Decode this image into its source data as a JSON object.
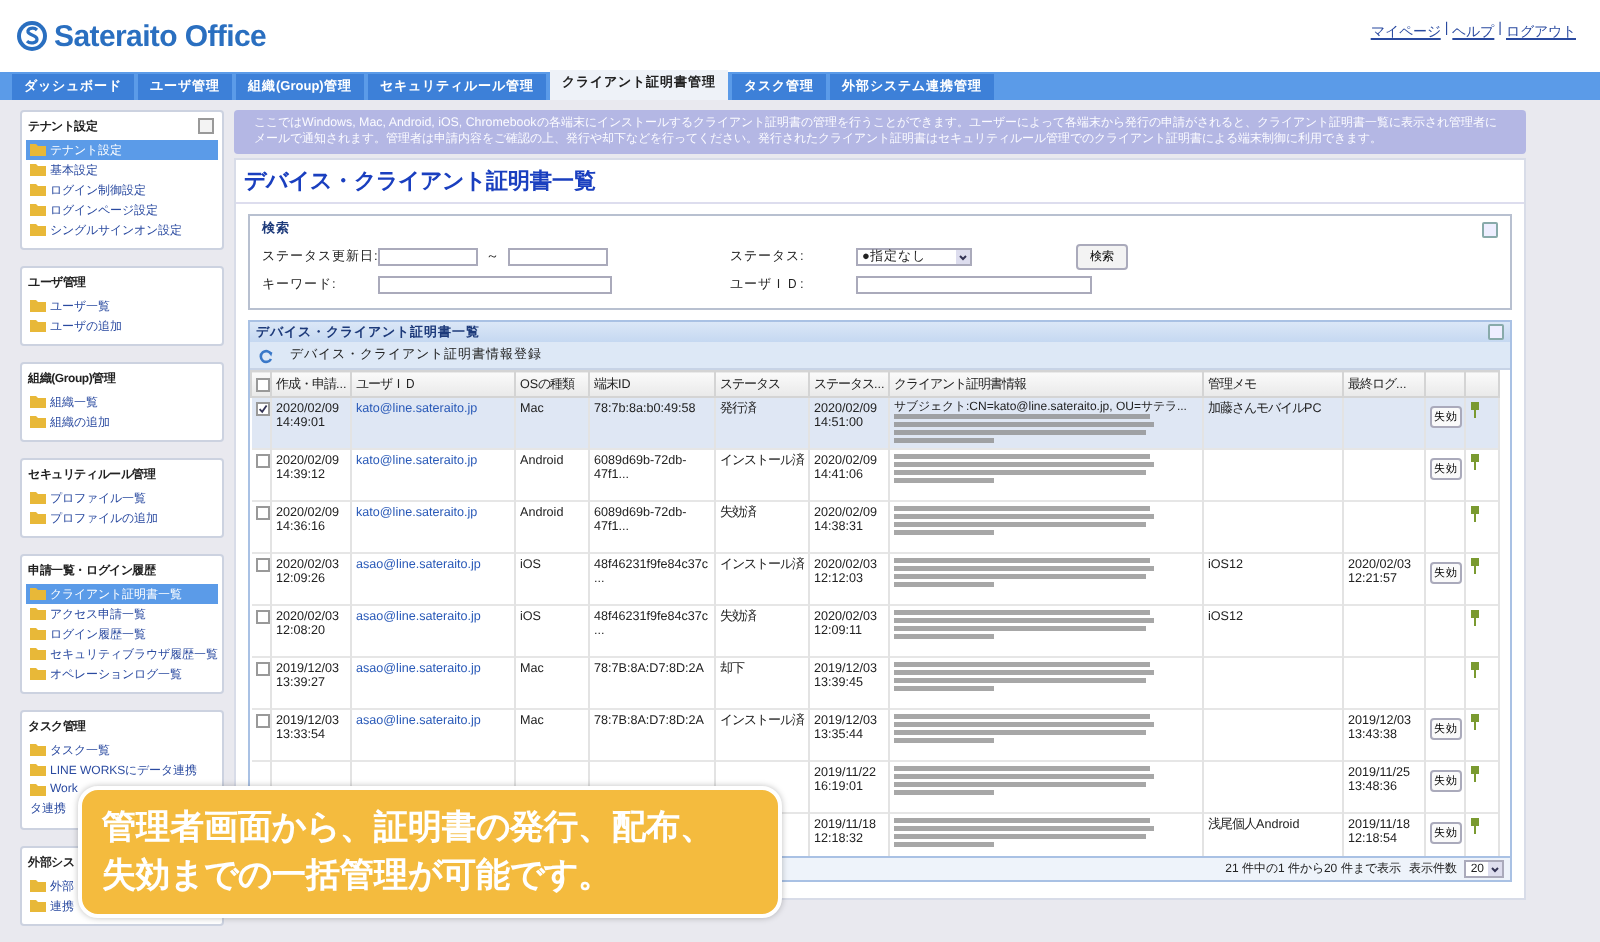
{
  "header": {
    "logo": "Sateraito Office",
    "links": [
      "マイページ",
      "ヘルプ",
      "ログアウト"
    ],
    "separator": "|"
  },
  "nav": [
    {
      "label": "ダッシュボード",
      "selected": false
    },
    {
      "label": "ユーザ管理",
      "selected": false
    },
    {
      "label": "組織(Group)管理",
      "selected": false
    },
    {
      "label": "セキュリティルール管理",
      "selected": false
    },
    {
      "label": "クライアント証明書管理",
      "selected": true
    },
    {
      "label": "タスク管理",
      "selected": false
    },
    {
      "label": "外部システム連携管理",
      "selected": false
    }
  ],
  "sidebar": [
    {
      "title": "テナント設定",
      "collapsible": true,
      "items": [
        {
          "label": "テナント設定",
          "selected": true
        },
        {
          "label": "基本設定",
          "selected": false
        },
        {
          "label": "ログイン制御設定",
          "selected": false
        },
        {
          "label": "ログインページ設定",
          "selected": false
        },
        {
          "label": "シングルサインオン設定",
          "selected": false
        }
      ]
    },
    {
      "title": "ユーザ管理",
      "collapsible": false,
      "items": [
        {
          "label": "ユーザ一覧",
          "selected": false
        },
        {
          "label": "ユーザの追加",
          "selected": false
        }
      ]
    },
    {
      "title": "組織(Group)管理",
      "collapsible": false,
      "items": [
        {
          "label": "組織一覧",
          "selected": false
        },
        {
          "label": "組織の追加",
          "selected": false
        }
      ]
    },
    {
      "title": "セキュリティルール管理",
      "collapsible": false,
      "items": [
        {
          "label": "プロファイル一覧",
          "selected": false
        },
        {
          "label": "プロファイルの追加",
          "selected": false
        }
      ]
    },
    {
      "title": "申請一覧・ログイン履歴",
      "collapsible": false,
      "items": [
        {
          "label": "クライアント証明書一覧",
          "selected": true
        },
        {
          "label": "アクセス申請一覧",
          "selected": false
        },
        {
          "label": "ログイン履歴一覧",
          "selected": false
        },
        {
          "label": "セキュリティブラウザ履歴一覧",
          "selected": false
        },
        {
          "label": "オペレーションログ一覧",
          "selected": false
        }
      ]
    },
    {
      "title": "タスク管理",
      "collapsible": false,
      "items": [
        {
          "label": "タスク一覧",
          "selected": false
        },
        {
          "label": "LINE WORKSにデータ連携",
          "selected": false
        },
        {
          "label": "Work",
          "continued": "タ連携",
          "selected": false
        }
      ]
    },
    {
      "title": "外部シス",
      "items": [
        {
          "label": "外部",
          "selected": false
        },
        {
          "label": "連携",
          "selected": false
        }
      ]
    }
  ],
  "info": "ここではWindows, Mac, Android, iOS, Chromebookの各端末にインストールするクライアント証明書の管理を行うことができます。ユーザーによって各端末から発行の申請がされると、クライアント証明書一覧に表示され管理者にメールで通知されます。管理者は申請内容をご確認の上、発行や却下などを行ってください。発行されたクライアント証明書はセキュリティルール管理でのクライアント証明書による端末制御に利用できます。",
  "page_title": "デバイス・クライアント証明書一覧",
  "search": {
    "title": "検索",
    "date_label": "ステータス更新日:",
    "date_separator": "～",
    "status_label": "ステータス:",
    "status_value": "●指定なし",
    "button": "検索",
    "keyword_label": "キーワード:",
    "userid_label": "ユーザＩＤ:"
  },
  "table": {
    "title": "デバイス・クライアント証明書一覧",
    "toolbar": "デバイス・クライアント証明書情報登録",
    "select_all": false,
    "columns": [
      "作成・申請...",
      "ユーザＩＤ",
      "OSの種類",
      "端末ID",
      "ステータス",
      "ステータス...",
      "クライアント証明書情報",
      "管理メモ",
      "最終ログ..."
    ],
    "rows": [
      {
        "selected": true,
        "created": "2020/02/09 14:49:01",
        "user": "kato@line.sateraito.jp",
        "os": "Mac",
        "device_id": "78:7b:8a:b0:49:58",
        "status": "発行済",
        "status_updated": "2020/02/09 14:51:00",
        "cert": "サブジェクト:CN=kato@line.sateraito.jp, OU=サテラ...",
        "memo": "加藤さんモバイルPC",
        "button": "失効"
      },
      {
        "selected": false,
        "created": "2020/02/09 14:39:12",
        "user": "kato@line.sateraito.jp",
        "os": "Android",
        "device_id": "6089d69b-72db-47f1...",
        "status": "インストール済",
        "status_updated": "2020/02/09 14:41:06",
        "button": "失効"
      },
      {
        "selected": false,
        "created": "2020/02/09 14:36:16",
        "user": "kato@line.sateraito.jp",
        "os": "Android",
        "device_id": "6089d69b-72db-47f1...",
        "status": "失効済",
        "status_updated": "2020/02/09 14:38:31"
      },
      {
        "selected": false,
        "created": "2020/02/03 12:09:26",
        "user": "asao@line.sateraito.jp",
        "os": "iOS",
        "device_id": "48f46231f9fe84c37c...",
        "status": "インストール済",
        "status_updated": "2020/02/03 12:12:03",
        "memo": "iOS12",
        "last_login": "2020/02/03 12:21:57",
        "button": "失効"
      },
      {
        "selected": false,
        "created": "2020/02/03 12:08:20",
        "user": "asao@line.sateraito.jp",
        "os": "iOS",
        "device_id": "48f46231f9fe84c37c...",
        "status": "失効済",
        "status_updated": "2020/02/03 12:09:11",
        "memo": "iOS12"
      },
      {
        "selected": false,
        "created": "2019/12/03 13:39:27",
        "user": "asao@line.sateraito.jp",
        "os": "Mac",
        "device_id": "78:7B:8A:D7:8D:2A",
        "status": "却下",
        "status_updated": "2019/12/03 13:39:45"
      },
      {
        "selected": false,
        "created": "2019/12/03 13:33:54",
        "user": "asao@line.sateraito.jp",
        "os": "Mac",
        "device_id": "78:7B:8A:D7:8D:2A",
        "status": "インストール済",
        "status_updated": "2019/12/03 13:35:44",
        "last_login": "2019/12/03 13:43:38",
        "button": "失効"
      },
      {
        "status_updated": "2019/11/22 16:19:01",
        "last_login": "2019/11/25 13:48:36",
        "button": "失効"
      },
      {
        "status_updated": "2019/11/18 12:18:32",
        "memo": "浅尾個人Android",
        "last_login": "2019/11/18 12:18:54",
        "button": "失効"
      }
    ],
    "pager": "21 件中の1 件から20 件まで表示",
    "page_size_label": "表示件数",
    "page_size": "20"
  },
  "banner": [
    "管理者画面から、証明書の発行、配布、",
    "失効までの一括管理が可能です。"
  ]
}
